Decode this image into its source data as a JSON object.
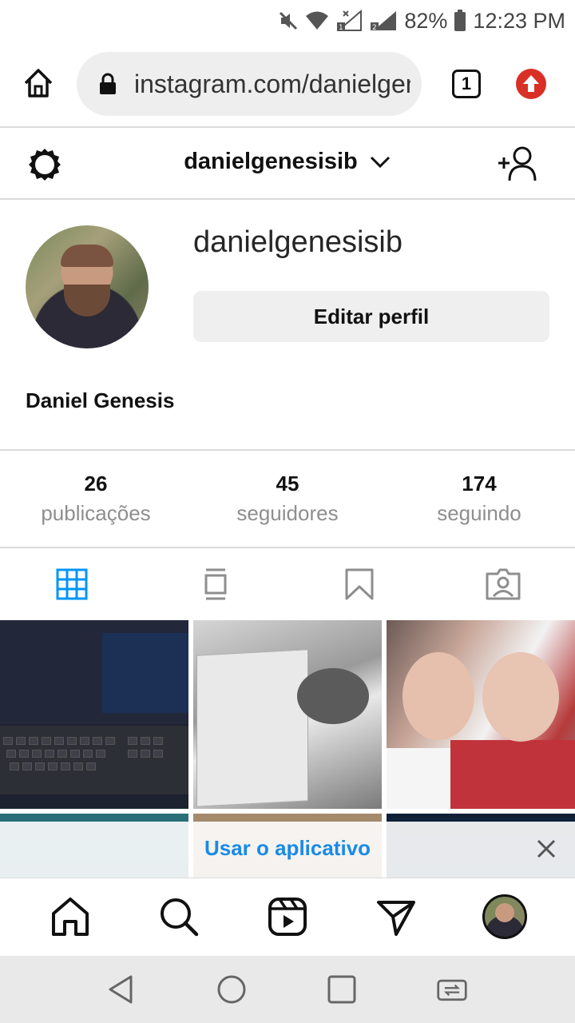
{
  "status_bar": {
    "battery": "82%",
    "time": "12:23 PM"
  },
  "browser": {
    "url": "instagram.com/danielgenesisib",
    "tab_count": "1"
  },
  "header": {
    "username": "danielgenesisib"
  },
  "profile": {
    "username": "danielgenesisib",
    "edit_label": "Editar perfil",
    "full_name": "Daniel Genesis"
  },
  "stats": [
    {
      "value": "26",
      "label": "publicações"
    },
    {
      "value": "45",
      "label": "seguidores"
    },
    {
      "value": "174",
      "label": "seguindo"
    }
  ],
  "tabs": [
    {
      "icon": "grid-icon",
      "active": true
    },
    {
      "icon": "feed-icon",
      "active": false
    },
    {
      "icon": "saved-icon",
      "active": false
    },
    {
      "icon": "tagged-icon",
      "active": false
    }
  ],
  "banner": {
    "label": "Usar o aplicativo"
  },
  "bottom_nav": [
    "home-icon",
    "search-icon",
    "reels-icon",
    "direct-icon",
    "profile-avatar"
  ],
  "colors": {
    "accent": "#0095f6",
    "link": "#1a8ae6",
    "update": "#d93025"
  }
}
